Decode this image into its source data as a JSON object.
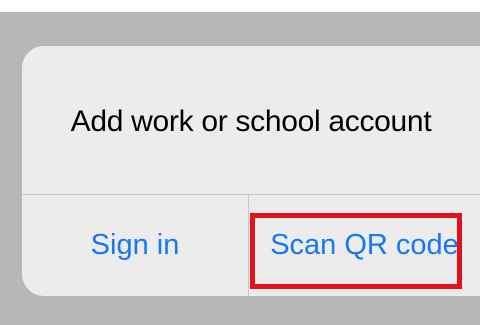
{
  "dialog": {
    "title": "Add work or school account",
    "actions": {
      "sign_in": "Sign in",
      "scan_qr": "Scan QR code"
    }
  },
  "colors": {
    "backdrop": "#b7b7b8",
    "dialog_background": "#ececec",
    "action_text": "#1877f2",
    "highlight_border": "#e3101e"
  }
}
